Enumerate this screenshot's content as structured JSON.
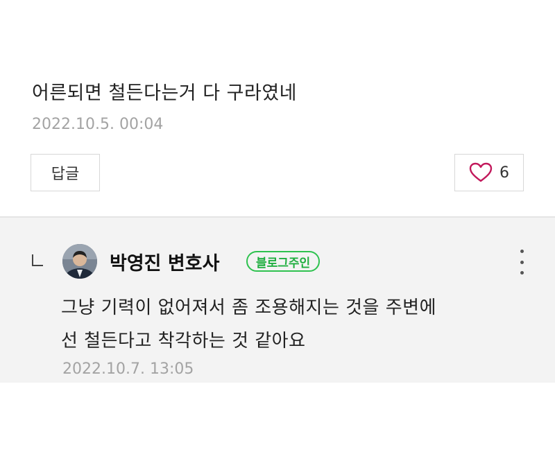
{
  "comment": {
    "text": "어른되면 철든다는거 다 구라였네",
    "date": "2022.10.5. 00:04",
    "reply_label": "답글",
    "like_icon": "heart-outline-icon",
    "like_count": "6",
    "like_color": "#c2185b"
  },
  "reply": {
    "arrow_icon": "reply-arrow-icon",
    "author": "박영진 변호사",
    "badge": "블로그주인",
    "badge_color": "#2ec24f",
    "more_icon": "more-vertical-icon",
    "text_line1": "그냥 기력이 없어져서 좀 조용해지는 것을 주변에",
    "text_line2": "선 철든다고 착각하는 것 같아요",
    "date": "2022.10.7. 13:05"
  }
}
